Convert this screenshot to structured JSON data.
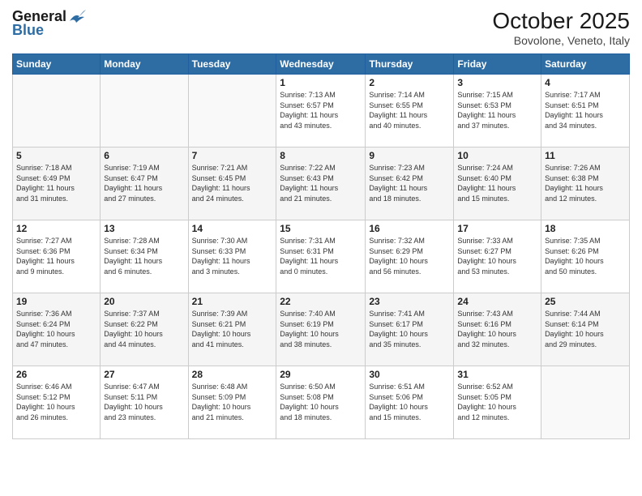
{
  "header": {
    "logo_general": "General",
    "logo_blue": "Blue",
    "month_title": "October 2025",
    "location": "Bovolone, Veneto, Italy"
  },
  "days_of_week": [
    "Sunday",
    "Monday",
    "Tuesday",
    "Wednesday",
    "Thursday",
    "Friday",
    "Saturday"
  ],
  "weeks": [
    [
      {
        "day": "",
        "info": ""
      },
      {
        "day": "",
        "info": ""
      },
      {
        "day": "",
        "info": ""
      },
      {
        "day": "1",
        "info": "Sunrise: 7:13 AM\nSunset: 6:57 PM\nDaylight: 11 hours\nand 43 minutes."
      },
      {
        "day": "2",
        "info": "Sunrise: 7:14 AM\nSunset: 6:55 PM\nDaylight: 11 hours\nand 40 minutes."
      },
      {
        "day": "3",
        "info": "Sunrise: 7:15 AM\nSunset: 6:53 PM\nDaylight: 11 hours\nand 37 minutes."
      },
      {
        "day": "4",
        "info": "Sunrise: 7:17 AM\nSunset: 6:51 PM\nDaylight: 11 hours\nand 34 minutes."
      }
    ],
    [
      {
        "day": "5",
        "info": "Sunrise: 7:18 AM\nSunset: 6:49 PM\nDaylight: 11 hours\nand 31 minutes."
      },
      {
        "day": "6",
        "info": "Sunrise: 7:19 AM\nSunset: 6:47 PM\nDaylight: 11 hours\nand 27 minutes."
      },
      {
        "day": "7",
        "info": "Sunrise: 7:21 AM\nSunset: 6:45 PM\nDaylight: 11 hours\nand 24 minutes."
      },
      {
        "day": "8",
        "info": "Sunrise: 7:22 AM\nSunset: 6:43 PM\nDaylight: 11 hours\nand 21 minutes."
      },
      {
        "day": "9",
        "info": "Sunrise: 7:23 AM\nSunset: 6:42 PM\nDaylight: 11 hours\nand 18 minutes."
      },
      {
        "day": "10",
        "info": "Sunrise: 7:24 AM\nSunset: 6:40 PM\nDaylight: 11 hours\nand 15 minutes."
      },
      {
        "day": "11",
        "info": "Sunrise: 7:26 AM\nSunset: 6:38 PM\nDaylight: 11 hours\nand 12 minutes."
      }
    ],
    [
      {
        "day": "12",
        "info": "Sunrise: 7:27 AM\nSunset: 6:36 PM\nDaylight: 11 hours\nand 9 minutes."
      },
      {
        "day": "13",
        "info": "Sunrise: 7:28 AM\nSunset: 6:34 PM\nDaylight: 11 hours\nand 6 minutes."
      },
      {
        "day": "14",
        "info": "Sunrise: 7:30 AM\nSunset: 6:33 PM\nDaylight: 11 hours\nand 3 minutes."
      },
      {
        "day": "15",
        "info": "Sunrise: 7:31 AM\nSunset: 6:31 PM\nDaylight: 11 hours\nand 0 minutes."
      },
      {
        "day": "16",
        "info": "Sunrise: 7:32 AM\nSunset: 6:29 PM\nDaylight: 10 hours\nand 56 minutes."
      },
      {
        "day": "17",
        "info": "Sunrise: 7:33 AM\nSunset: 6:27 PM\nDaylight: 10 hours\nand 53 minutes."
      },
      {
        "day": "18",
        "info": "Sunrise: 7:35 AM\nSunset: 6:26 PM\nDaylight: 10 hours\nand 50 minutes."
      }
    ],
    [
      {
        "day": "19",
        "info": "Sunrise: 7:36 AM\nSunset: 6:24 PM\nDaylight: 10 hours\nand 47 minutes."
      },
      {
        "day": "20",
        "info": "Sunrise: 7:37 AM\nSunset: 6:22 PM\nDaylight: 10 hours\nand 44 minutes."
      },
      {
        "day": "21",
        "info": "Sunrise: 7:39 AM\nSunset: 6:21 PM\nDaylight: 10 hours\nand 41 minutes."
      },
      {
        "day": "22",
        "info": "Sunrise: 7:40 AM\nSunset: 6:19 PM\nDaylight: 10 hours\nand 38 minutes."
      },
      {
        "day": "23",
        "info": "Sunrise: 7:41 AM\nSunset: 6:17 PM\nDaylight: 10 hours\nand 35 minutes."
      },
      {
        "day": "24",
        "info": "Sunrise: 7:43 AM\nSunset: 6:16 PM\nDaylight: 10 hours\nand 32 minutes."
      },
      {
        "day": "25",
        "info": "Sunrise: 7:44 AM\nSunset: 6:14 PM\nDaylight: 10 hours\nand 29 minutes."
      }
    ],
    [
      {
        "day": "26",
        "info": "Sunrise: 6:46 AM\nSunset: 5:12 PM\nDaylight: 10 hours\nand 26 minutes."
      },
      {
        "day": "27",
        "info": "Sunrise: 6:47 AM\nSunset: 5:11 PM\nDaylight: 10 hours\nand 23 minutes."
      },
      {
        "day": "28",
        "info": "Sunrise: 6:48 AM\nSunset: 5:09 PM\nDaylight: 10 hours\nand 21 minutes."
      },
      {
        "day": "29",
        "info": "Sunrise: 6:50 AM\nSunset: 5:08 PM\nDaylight: 10 hours\nand 18 minutes."
      },
      {
        "day": "30",
        "info": "Sunrise: 6:51 AM\nSunset: 5:06 PM\nDaylight: 10 hours\nand 15 minutes."
      },
      {
        "day": "31",
        "info": "Sunrise: 6:52 AM\nSunset: 5:05 PM\nDaylight: 10 hours\nand 12 minutes."
      },
      {
        "day": "",
        "info": ""
      }
    ]
  ]
}
